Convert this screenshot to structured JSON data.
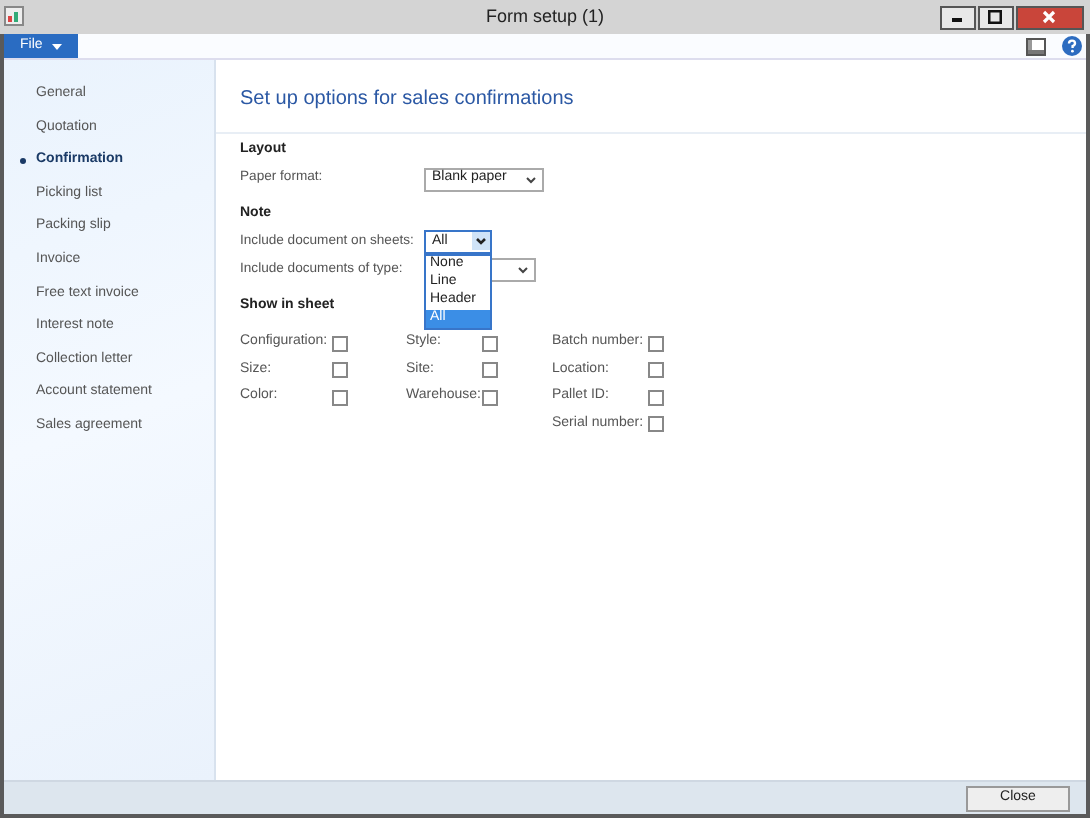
{
  "window": {
    "title": "Form setup (1)"
  },
  "menu": {
    "file": "File"
  },
  "sidebar": {
    "items": [
      {
        "label": "General",
        "selected": false
      },
      {
        "label": "Quotation",
        "selected": false
      },
      {
        "label": "Confirmation",
        "selected": true
      },
      {
        "label": "Picking list",
        "selected": false
      },
      {
        "label": "Packing slip",
        "selected": false
      },
      {
        "label": "Invoice",
        "selected": false
      },
      {
        "label": "Free text invoice",
        "selected": false
      },
      {
        "label": "Interest note",
        "selected": false
      },
      {
        "label": "Collection letter",
        "selected": false
      },
      {
        "label": "Account statement",
        "selected": false
      },
      {
        "label": "Sales agreement",
        "selected": false
      }
    ]
  },
  "content": {
    "title": "Set up options for sales confirmations",
    "layout": {
      "heading": "Layout",
      "paper_format": {
        "label": "Paper format:",
        "value": "Blank paper"
      }
    },
    "note": {
      "heading": "Note",
      "include_on_sheets": {
        "label": "Include document on sheets:",
        "value": "All",
        "expanded": true,
        "options": [
          {
            "label": "None",
            "selected": false
          },
          {
            "label": "Line",
            "selected": false
          },
          {
            "label": "Header",
            "selected": false
          },
          {
            "label": "All",
            "selected": true
          }
        ]
      },
      "include_of_type": {
        "label": "Include documents of type:"
      }
    },
    "show_in_sheet": {
      "heading": "Show in sheet",
      "columns": [
        [
          {
            "label": "Configuration:",
            "checked": false
          },
          {
            "label": "Size:",
            "checked": false
          },
          {
            "label": "Color:",
            "checked": false
          }
        ],
        [
          {
            "label": "Style:",
            "checked": false
          },
          {
            "label": "Site:",
            "checked": false
          },
          {
            "label": "Warehouse:",
            "checked": false
          }
        ],
        [
          {
            "label": "Batch number:",
            "checked": false
          },
          {
            "label": "Location:",
            "checked": false
          },
          {
            "label": "Pallet ID:",
            "checked": false
          },
          {
            "label": "Serial number:",
            "checked": false
          }
        ]
      ]
    }
  },
  "footer": {
    "close": "Close"
  }
}
